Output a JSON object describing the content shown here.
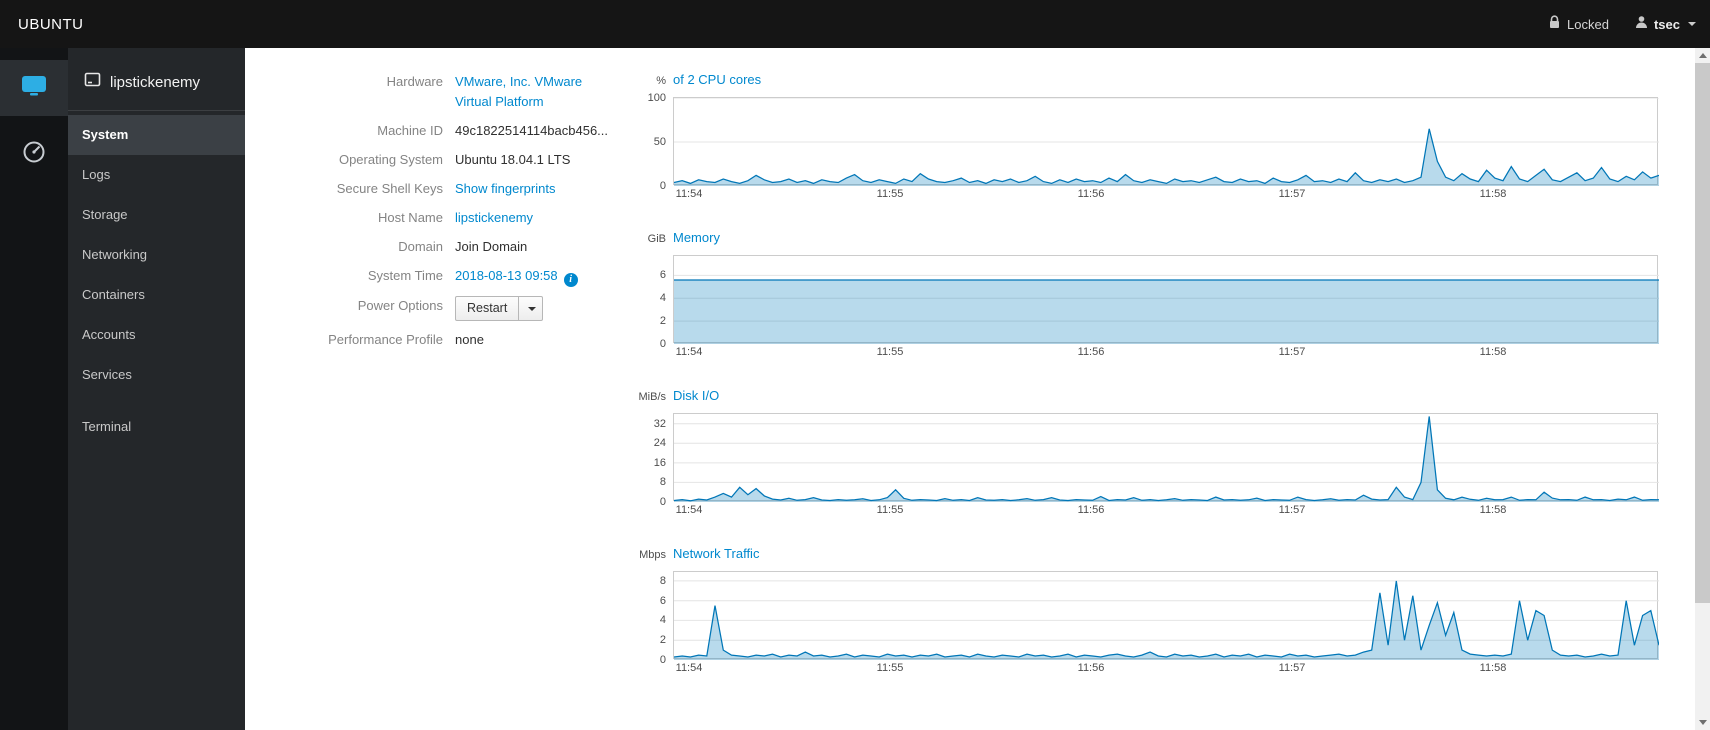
{
  "navbar": {
    "brand": "UBUNTU",
    "locked_label": "Locked",
    "user": "tsec"
  },
  "sidebar": {
    "host": "lipstickenemy",
    "items": [
      {
        "label": "System",
        "active": true
      },
      {
        "label": "Logs"
      },
      {
        "label": "Storage"
      },
      {
        "label": "Networking"
      },
      {
        "label": "Containers"
      },
      {
        "label": "Accounts"
      },
      {
        "label": "Services"
      },
      {
        "label": "Terminal",
        "separated": true
      }
    ]
  },
  "info": {
    "rows": [
      {
        "label": "Hardware",
        "value": "VMware, Inc. VMware Virtual Platform"
      },
      {
        "label": "Machine ID",
        "value": "49c1822514114bacb456..."
      },
      {
        "label": "Operating System",
        "value": "Ubuntu 18.04.1 LTS"
      },
      {
        "label": "Secure Shell Keys",
        "value": "Show fingerprints"
      },
      {
        "label": "Host Name",
        "value": "lipstickenemy"
      },
      {
        "label": "Domain",
        "value": "Join Domain"
      },
      {
        "label": "System Time",
        "value": "2018-08-13 09:58"
      },
      {
        "label": "Power Options",
        "value": "Restart"
      },
      {
        "label": "Performance Profile",
        "value": "none"
      }
    ]
  },
  "colors": {
    "accent": "#0088ce",
    "chart_stroke": "#0076b7",
    "chart_fill": "rgba(0,123,187,0.28)"
  },
  "chart_data": [
    {
      "type": "area",
      "unit": "%",
      "title": "of 2 CPU cores",
      "ylim": [
        0,
        100
      ],
      "yticks": [
        0,
        50,
        100
      ],
      "x_labels": [
        "11:54",
        "11:55",
        "11:56",
        "11:57",
        "11:58"
      ],
      "x_tick_fracs": [
        0.016,
        0.22,
        0.424,
        0.628,
        0.832
      ],
      "stroke": "#0076b7",
      "fill": "rgba(0,123,187,0.28)",
      "values": [
        4,
        6,
        3,
        7,
        5,
        4,
        8,
        5,
        3,
        6,
        12,
        7,
        4,
        5,
        8,
        4,
        6,
        3,
        7,
        5,
        4,
        9,
        13,
        6,
        4,
        7,
        5,
        3,
        8,
        5,
        14,
        8,
        5,
        4,
        6,
        9,
        4,
        6,
        3,
        7,
        5,
        8,
        4,
        6,
        11,
        5,
        3,
        7,
        4,
        8,
        5,
        6,
        4,
        9,
        5,
        13,
        6,
        4,
        7,
        5,
        3,
        8,
        5,
        6,
        4,
        7,
        10,
        5,
        4,
        8,
        5,
        6,
        3,
        9,
        5,
        4,
        7,
        12,
        5,
        6,
        4,
        8,
        5,
        15,
        6,
        4,
        7,
        5,
        8,
        4,
        6,
        10,
        65,
        28,
        10,
        6,
        14,
        8,
        5,
        18,
        9,
        6,
        22,
        8,
        5,
        12,
        19,
        7,
        5,
        10,
        15,
        6,
        9,
        21,
        8,
        5,
        11,
        7,
        16,
        9,
        12
      ]
    },
    {
      "type": "area",
      "unit": "GiB",
      "title": "Memory",
      "ylim": [
        0,
        7.7
      ],
      "yticks": [
        0,
        2,
        4,
        6
      ],
      "x_labels": [
        "11:54",
        "11:55",
        "11:56",
        "11:57",
        "11:58"
      ],
      "x_tick_fracs": [
        0.016,
        0.22,
        0.424,
        0.628,
        0.832
      ],
      "stroke": "#0076b7",
      "fill": "rgba(0,123,187,0.28)",
      "values": [
        5.6,
        5.6
      ]
    },
    {
      "type": "area",
      "unit": "MiB/s",
      "title": "Disk I/O",
      "ylim": [
        0,
        36
      ],
      "yticks": [
        0,
        8,
        16,
        24,
        32
      ],
      "x_labels": [
        "11:54",
        "11:55",
        "11:56",
        "11:57",
        "11:58"
      ],
      "x_tick_fracs": [
        0.016,
        0.22,
        0.424,
        0.628,
        0.832
      ],
      "stroke": "#0076b7",
      "fill": "rgba(0,123,187,0.28)",
      "values": [
        0.6,
        1,
        0.5,
        1.2,
        0.8,
        2,
        3.5,
        2,
        6,
        3,
        5.5,
        2.5,
        1.2,
        0.8,
        1.5,
        0.7,
        1,
        1.8,
        0.8,
        0.6,
        1,
        0.7,
        0.9,
        1.3,
        0.6,
        0.9,
        1.8,
        5,
        1.5,
        0.7,
        1,
        0.8,
        0.6,
        1.4,
        0.7,
        1,
        0.6,
        1.8,
        0.8,
        0.7,
        1,
        0.6,
        0.9,
        1.4,
        0.7,
        1,
        1.8,
        0.8,
        0.6,
        1,
        0.8,
        0.7,
        2.2,
        0.6,
        1,
        0.8,
        1.8,
        0.7,
        1,
        0.6,
        0.9,
        1.4,
        0.7,
        1,
        0.8,
        0.6,
        2,
        0.8,
        1,
        0.7,
        0.9,
        1.6,
        0.6,
        1,
        0.8,
        0.7,
        2,
        1,
        0.6,
        0.9,
        1.3,
        0.7,
        1,
        0.8,
        2.8,
        1.2,
        0.8,
        1,
        6,
        2,
        1,
        8,
        35,
        5,
        1.5,
        0.9,
        2,
        1.1,
        0.7,
        1.5,
        0.9,
        1,
        2,
        0.7,
        1,
        0.9,
        4,
        1.6,
        0.9,
        1,
        0.7,
        2,
        0.9,
        1,
        0.6,
        1.2,
        0.9,
        2,
        0.7,
        1,
        0.9
      ]
    },
    {
      "type": "area",
      "unit": "Mbps",
      "title": "Network Traffic",
      "ylim": [
        0,
        8.9
      ],
      "yticks": [
        0,
        2,
        4,
        6,
        8
      ],
      "x_labels": [
        "11:54",
        "11:55",
        "11:56",
        "11:57",
        "11:58"
      ],
      "x_tick_fracs": [
        0.016,
        0.22,
        0.424,
        0.628,
        0.832
      ],
      "stroke": "#0076b7",
      "fill": "rgba(0,123,187,0.28)",
      "values": [
        0.3,
        0.4,
        0.3,
        0.5,
        0.4,
        5.5,
        1,
        0.5,
        0.4,
        0.3,
        0.5,
        0.4,
        0.6,
        0.3,
        0.5,
        0.4,
        0.8,
        0.4,
        0.5,
        0.3,
        0.4,
        0.6,
        0.3,
        0.5,
        0.4,
        0.3,
        0.6,
        0.4,
        0.5,
        0.3,
        0.5,
        0.4,
        0.6,
        0.3,
        0.4,
        0.5,
        0.3,
        0.6,
        0.4,
        0.3,
        0.5,
        0.4,
        0.3,
        0.6,
        0.4,
        0.5,
        0.3,
        0.4,
        0.6,
        0.3,
        0.5,
        0.4,
        0.3,
        0.5,
        0.6,
        0.4,
        0.3,
        0.5,
        0.8,
        0.4,
        0.3,
        0.6,
        0.4,
        0.5,
        0.3,
        0.4,
        0.6,
        0.3,
        0.5,
        0.4,
        0.6,
        0.3,
        0.5,
        0.4,
        0.3,
        0.6,
        0.4,
        0.5,
        0.3,
        0.4,
        0.5,
        0.6,
        0.4,
        0.5,
        0.8,
        1,
        6.8,
        1.5,
        8,
        2,
        6.5,
        1,
        3.5,
        5.8,
        2.5,
        4.8,
        1,
        0.6,
        0.5,
        0.4,
        0.5,
        0.4,
        0.6,
        6,
        2,
        5,
        4.5,
        1,
        0.5,
        0.4,
        0.5,
        0.3,
        0.4,
        0.6,
        0.4,
        0.5,
        6,
        1.5,
        4.5,
        5,
        1.5
      ]
    }
  ]
}
